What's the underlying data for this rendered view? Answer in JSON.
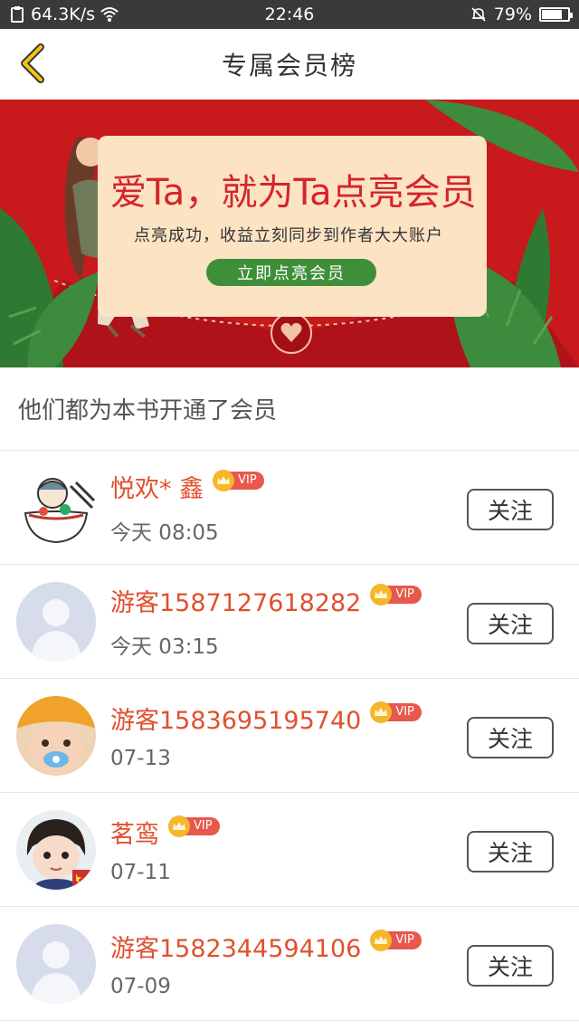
{
  "status_bar": {
    "speed": "64.3K/s",
    "time": "22:46",
    "battery": "79%",
    "battery_level": 0.79
  },
  "nav": {
    "title": "专属会员榜"
  },
  "banner": {
    "headline": "爱Ta，就为Ta点亮会员",
    "subtitle": "点亮成功，收益立刻同步到作者大大账户",
    "cta": "立即点亮会员"
  },
  "section": {
    "title": "他们都为本书开通了会员"
  },
  "vip_label": "VIP",
  "follow_label": "关注",
  "members": [
    {
      "name": "悦欢* 鑫",
      "time": "今天 08:05",
      "avatar": "cartoon-bowl-avatar"
    },
    {
      "name": "游客1587127618282",
      "time": "今天 03:15",
      "avatar": "default-person-avatar"
    },
    {
      "name": "游客1583695195740",
      "time": "07-13",
      "avatar": "baby-photo-avatar"
    },
    {
      "name": "茗鸾",
      "time": "07-11",
      "avatar": "girl-photo-avatar"
    },
    {
      "name": "游客1582344594106",
      "time": "07-09",
      "avatar": "default-person-avatar"
    }
  ],
  "colors": {
    "accent": "#e0502e",
    "banner_red": "#c8191c",
    "vip_badge": "#e7584d",
    "crown": "#f5b62b"
  }
}
